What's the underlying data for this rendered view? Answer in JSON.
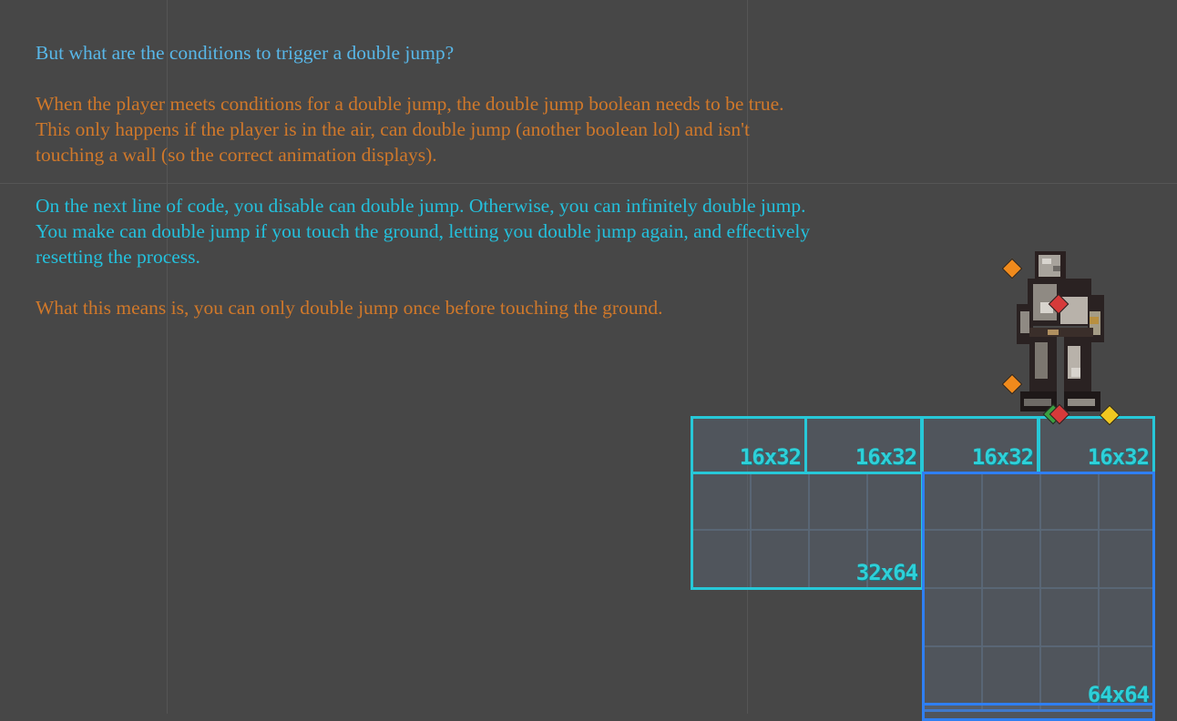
{
  "notes": {
    "heading": "But what are the conditions to trigger a double jump?",
    "para_conditions": "When the player meets conditions for a double jump, the double jump boolean needs to be true.\nThis only happens if the player is in the air, can double jump (another boolean lol) and isn't\ntouching a wall (so the correct animation displays).",
    "para_disable": "On the next line of code, you disable can double jump. Otherwise, you can infinitely double jump.\nYou make can double jump if you touch the ground, letting you double jump again, and effectively\nresetting the process.",
    "para_summary": "What this means is, you can only double jump once before touching the ground."
  },
  "tiles": {
    "small_1": "16x32",
    "small_2": "16x32",
    "small_3": "16x32",
    "small_4": "16x32",
    "medium": "32x64",
    "large": "64x64"
  },
  "colors": {
    "background": "#474747",
    "heading_text": "#58b7e8",
    "orange_text": "#d0782a",
    "cyan_text": "#24c0dc",
    "tile_border_cyan": "#27c8d8",
    "tile_border_blue": "#2f7ff2"
  },
  "gizmos": [
    "orange-diamond",
    "red-diamond",
    "yellow-diamond",
    "green-diamond"
  ]
}
